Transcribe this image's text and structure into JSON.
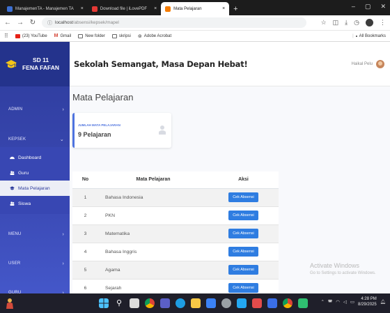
{
  "browser": {
    "tabs": [
      {
        "label": "ManajemenTA - Manajemen TA",
        "favicon_color": "#3c6fd1",
        "active": false
      },
      {
        "label": "Download file | iLovePDF",
        "favicon_color": "#e53935",
        "active": false
      },
      {
        "label": "Mata Pelajaran",
        "favicon_color": "#f57c00",
        "active": true
      }
    ],
    "url_host": "localhost",
    "url_path": "/absensi/kepsek/mapel",
    "bookmarks": [
      {
        "label": "(23) YouTube",
        "color": "#e62117"
      },
      {
        "label": "Gmail",
        "color": "#d44638"
      },
      {
        "label": "New folder",
        "color": "#666666"
      },
      {
        "label": "skripsi",
        "color": "#666666"
      },
      {
        "label": "Adobe Acrobat",
        "color": "#333333"
      }
    ],
    "all_bookmarks": "All Bookmarks"
  },
  "sidebar": {
    "brand_line1": "SD 11",
    "brand_line2": "FENA FAFAN",
    "groups": {
      "admin": "ADMIN",
      "kepsek": "KEPSEK",
      "menu": "MENU",
      "user": "USER",
      "guru": "GURU"
    },
    "kepsek_items": [
      {
        "label": "Dashboard",
        "active": false
      },
      {
        "label": "Guru",
        "active": false
      },
      {
        "label": "Mata Pelajaran",
        "active": true
      },
      {
        "label": "Siswa",
        "active": false
      }
    ]
  },
  "topbar": {
    "tagline": "Sekolah Semangat, Masa Depan Hebat!",
    "user_name": "Haikal Pelu"
  },
  "main": {
    "title": "Mata Pelajaran",
    "stat": {
      "label": "JUMLAH MATA PELAJARAN",
      "value": "9 Pelajaran"
    },
    "table": {
      "headers": {
        "no": "No",
        "mapel": "Mata Pelajaran",
        "aksi": "Aksi"
      },
      "button_label": "Cek Absensi",
      "rows": [
        {
          "no": "1",
          "mapel": "Bahasa Indonesia"
        },
        {
          "no": "2",
          "mapel": "PKN"
        },
        {
          "no": "3",
          "mapel": "Matematika"
        },
        {
          "no": "4",
          "mapel": "Bahasa Inggris"
        },
        {
          "no": "5",
          "mapel": "Agama"
        },
        {
          "no": "6",
          "mapel": "Sejarah"
        }
      ]
    }
  },
  "watermark": {
    "line1": "Activate Windows",
    "line2": "Go to Settings to activate Windows."
  },
  "taskbar": {
    "time": "4:28 PM",
    "date": "8/29/2025"
  },
  "colors": {
    "sidebar": "#2d3b9b",
    "primary": "#4e73df",
    "button": "#2f7de1"
  }
}
